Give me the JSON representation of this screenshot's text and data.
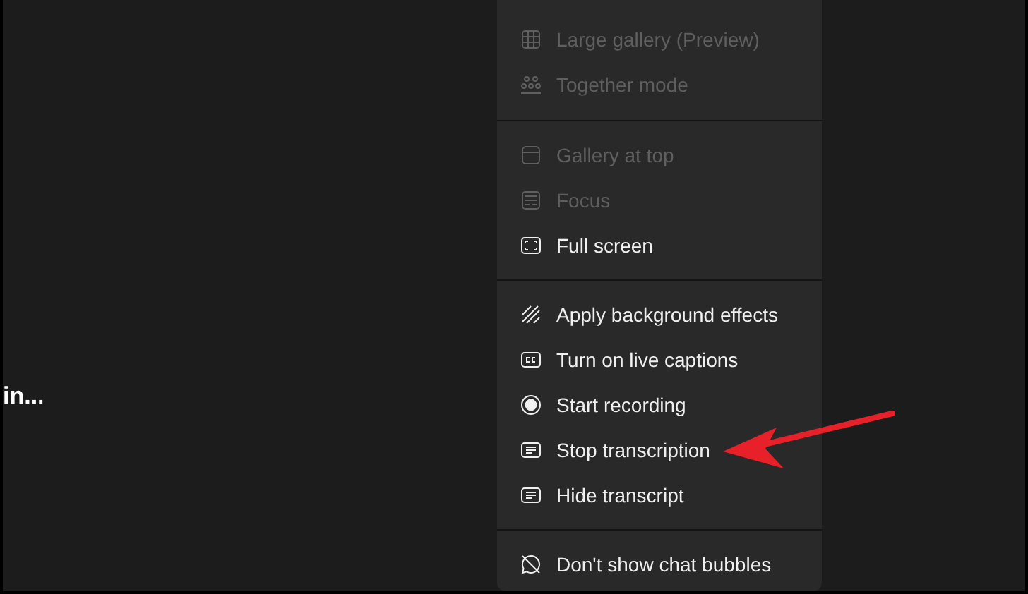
{
  "stage": {
    "caption": "in..."
  },
  "menu": {
    "sections": [
      {
        "items": [
          {
            "label": "Large gallery (Preview)",
            "disabled": true
          },
          {
            "label": "Together mode",
            "disabled": true
          }
        ]
      },
      {
        "items": [
          {
            "label": "Gallery at top",
            "disabled": true
          },
          {
            "label": "Focus",
            "disabled": true
          },
          {
            "label": "Full screen",
            "disabled": false
          }
        ]
      },
      {
        "items": [
          {
            "label": "Apply background effects",
            "disabled": false
          },
          {
            "label": "Turn on live captions",
            "disabled": false
          },
          {
            "label": "Start recording",
            "disabled": false
          },
          {
            "label": "Stop transcription",
            "disabled": false
          },
          {
            "label": "Hide transcript",
            "disabled": false
          }
        ]
      },
      {
        "items": [
          {
            "label": "Don't show chat bubbles",
            "disabled": false
          }
        ]
      }
    ]
  }
}
